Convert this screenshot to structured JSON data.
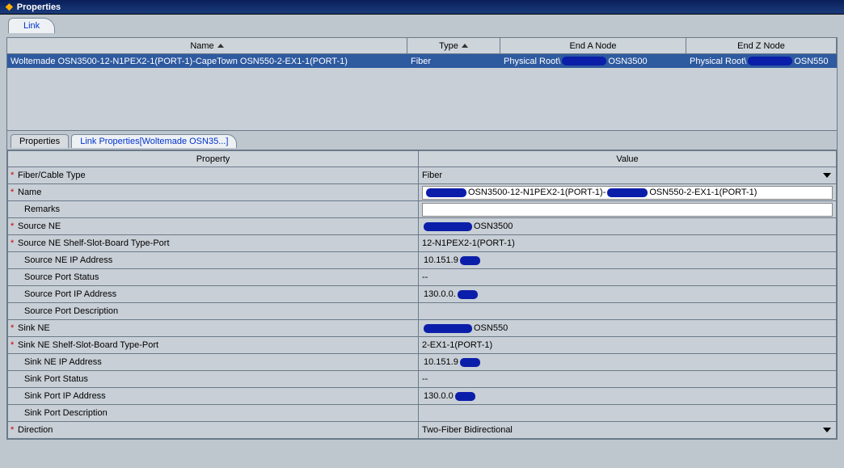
{
  "window": {
    "title": "Properties"
  },
  "topTabs": [
    {
      "label": "Link",
      "active": true
    }
  ],
  "grid": {
    "columns": [
      {
        "label": "Name",
        "sort": true
      },
      {
        "label": "Type",
        "sort": true
      },
      {
        "label": "End A Node",
        "sort": false
      },
      {
        "label": "End Z Node",
        "sort": false
      }
    ],
    "row": {
      "name": "Woltemade OSN3500-12-N1PEX2-1(PORT-1)-CapeTown OSN550-2-EX1-1(PORT-1)",
      "type": "Fiber",
      "endA_prefix": "Physical Root\\",
      "endA_suffix": " OSN3500",
      "endZ_prefix": "Physical Root\\",
      "endZ_suffix": " OSN550"
    }
  },
  "subTabs": {
    "propsLabel": "Properties",
    "linkPropsLabel": "Link Properties[Woltemade OSN35...]"
  },
  "propsHeader": {
    "property": "Property",
    "value": "Value"
  },
  "props": {
    "fiberCableType": {
      "label": "Fiber/Cable Type",
      "value": "Fiber",
      "required": true,
      "dropdown": true
    },
    "name": {
      "label": "Name",
      "required": true,
      "editable": true,
      "seg1": " OSN3500-12-N1PEX2-1(PORT-1)-",
      "seg2": " OSN550-2-EX1-1(PORT-1)"
    },
    "remarks": {
      "label": "Remarks",
      "value": "",
      "editable": true
    },
    "sourceNE": {
      "label": "Source NE",
      "required": true,
      "suffix": " OSN3500"
    },
    "sourceShelf": {
      "label": "Source NE Shelf-Slot-Board Type-Port",
      "required": true,
      "value": "12-N1PEX2-1(PORT-1)"
    },
    "sourceNEIP": {
      "label": "Source NE IP Address",
      "prefix": "10.151.9"
    },
    "sourcePortStatus": {
      "label": "Source Port Status",
      "value": "--"
    },
    "sourcePortIP": {
      "label": "Source Port IP Address",
      "prefix": "130.0.0."
    },
    "sourcePortDesc": {
      "label": "Source Port Description",
      "value": ""
    },
    "sinkNE": {
      "label": "Sink NE",
      "required": true,
      "suffix": "OSN550"
    },
    "sinkShelf": {
      "label": "Sink NE Shelf-Slot-Board Type-Port",
      "required": true,
      "value": "2-EX1-1(PORT-1)"
    },
    "sinkNEIP": {
      "label": "Sink NE IP Address",
      "prefix": "10.151.9"
    },
    "sinkPortStatus": {
      "label": "Sink Port Status",
      "value": "--"
    },
    "sinkPortIP": {
      "label": "Sink Port IP Address",
      "prefix": "130.0.0"
    },
    "sinkPortDesc": {
      "label": "Sink Port Description",
      "value": ""
    },
    "direction": {
      "label": "Direction",
      "required": true,
      "value": "Two-Fiber Bidirectional",
      "dropdown": true
    }
  }
}
